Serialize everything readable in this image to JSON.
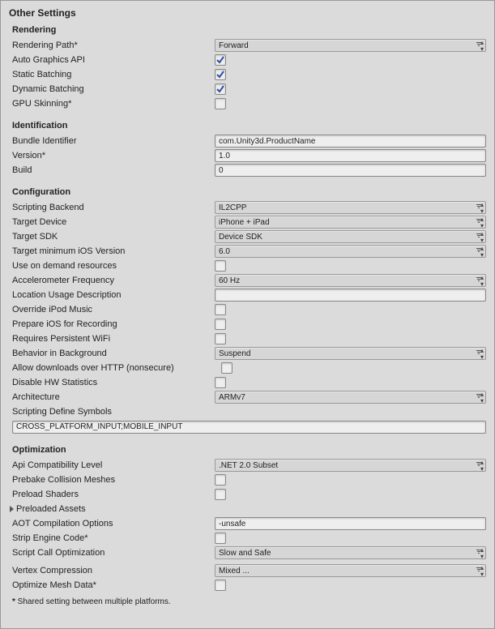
{
  "panelTitle": "Other Settings",
  "sections": {
    "rendering": {
      "title": "Rendering",
      "renderingPath": {
        "label": "Rendering Path*",
        "value": "Forward"
      },
      "autoGraphicsAPI": {
        "label": "Auto Graphics API",
        "checked": true
      },
      "staticBatching": {
        "label": "Static Batching",
        "checked": true
      },
      "dynamicBatching": {
        "label": "Dynamic Batching",
        "checked": true
      },
      "gpuSkinning": {
        "label": "GPU Skinning*",
        "checked": false
      }
    },
    "identification": {
      "title": "Identification",
      "bundleIdentifier": {
        "label": "Bundle Identifier",
        "value": "com.Unity3d.ProductName"
      },
      "version": {
        "label": "Version*",
        "value": "1.0"
      },
      "build": {
        "label": "Build",
        "value": "0"
      }
    },
    "configuration": {
      "title": "Configuration",
      "scriptingBackend": {
        "label": "Scripting Backend",
        "value": "IL2CPP"
      },
      "targetDevice": {
        "label": "Target Device",
        "value": "iPhone + iPad"
      },
      "targetSDK": {
        "label": "Target SDK",
        "value": "Device SDK"
      },
      "targetMinIOS": {
        "label": "Target minimum iOS Version",
        "value": "6.0"
      },
      "useOnDemand": {
        "label": "Use on demand resources",
        "checked": false
      },
      "accelFreq": {
        "label": "Accelerometer Frequency",
        "value": "60 Hz"
      },
      "locationUsage": {
        "label": "Location Usage Description",
        "value": ""
      },
      "overrideIpod": {
        "label": "Override iPod Music",
        "checked": false
      },
      "prepareRecording": {
        "label": "Prepare iOS for Recording",
        "checked": false
      },
      "requiresWifi": {
        "label": "Requires Persistent WiFi",
        "checked": false
      },
      "backgroundBehavior": {
        "label": "Behavior in Background",
        "value": "Suspend"
      },
      "allowHttp": {
        "label": "Allow downloads over HTTP (nonsecure)",
        "checked": false
      },
      "disableHwStats": {
        "label": "Disable HW Statistics",
        "checked": false
      },
      "architecture": {
        "label": "Architecture",
        "value": "ARMv7"
      },
      "scriptingDefine": {
        "label": "Scripting Define Symbols",
        "value": "CROSS_PLATFORM_INPUT;MOBILE_INPUT"
      }
    },
    "optimization": {
      "title": "Optimization",
      "apiCompat": {
        "label": "Api Compatibility Level",
        "value": ".NET 2.0 Subset"
      },
      "prebakeCollision": {
        "label": "Prebake Collision Meshes",
        "checked": false
      },
      "preloadShaders": {
        "label": "Preload Shaders",
        "checked": false
      },
      "preloadedAssets": {
        "label": "Preloaded Assets"
      },
      "aotOptions": {
        "label": "AOT Compilation Options",
        "value": "-unsafe"
      },
      "stripEngine": {
        "label": "Strip Engine Code*",
        "checked": false
      },
      "scriptCallOpt": {
        "label": "Script Call Optimization",
        "value": "Slow and Safe"
      },
      "vertexCompression": {
        "label": "Vertex Compression",
        "value": "Mixed ..."
      },
      "optimizeMesh": {
        "label": "Optimize Mesh Data*",
        "checked": false
      }
    }
  },
  "footnote": "Shared setting between multiple platforms."
}
